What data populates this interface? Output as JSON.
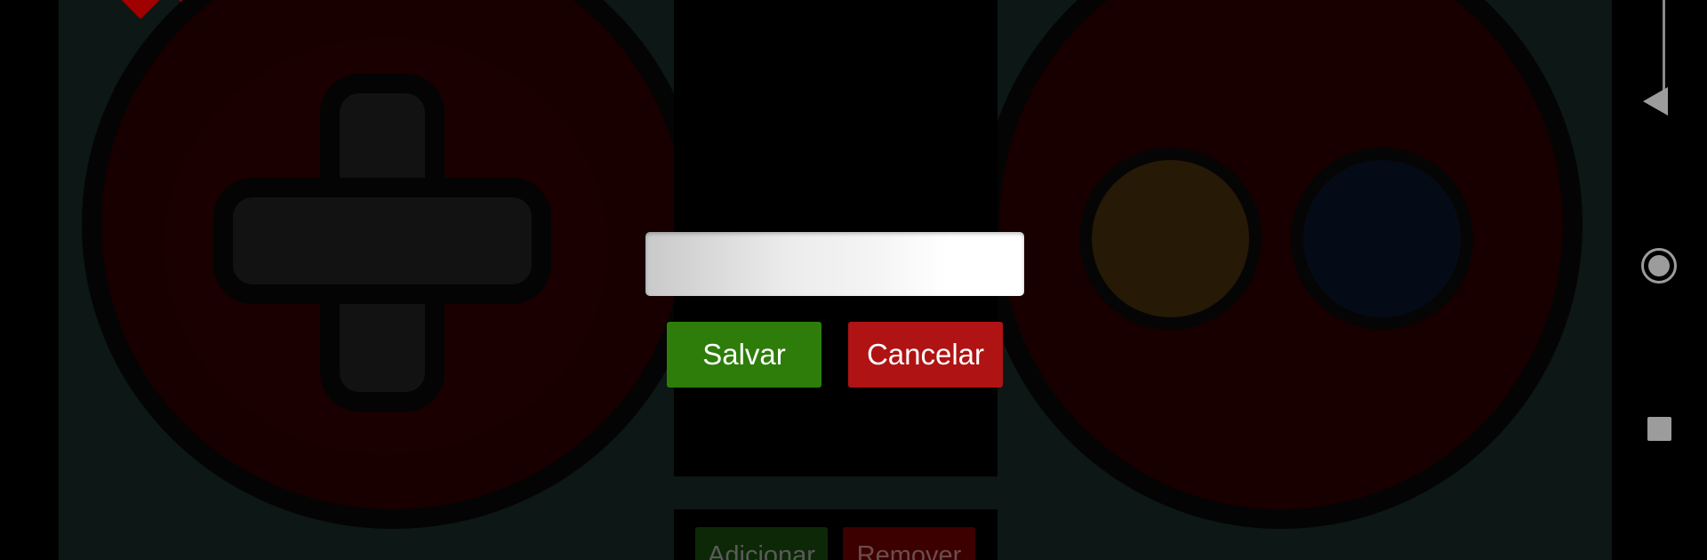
{
  "dialog": {
    "name_input": {
      "value": "",
      "placeholder": ""
    },
    "save_label": "Salvar",
    "cancel_label": "Cancelar"
  },
  "toolbar": {
    "add_label": "Adicionar",
    "remove_label": "Remover"
  },
  "controller": {
    "left_pad": {
      "icon": "dpad-icon"
    },
    "right_pad": {
      "buttons": [
        {
          "name": "yellow-face-button",
          "color": "#261906"
        },
        {
          "name": "blue-face-button",
          "color": "#050b16"
        }
      ]
    }
  },
  "nav_bar": {
    "icons": [
      "back-icon",
      "home-icon",
      "recent-apps-icon"
    ]
  },
  "colors": {
    "save": "#2e7d0a",
    "cancel": "#b01313",
    "pad_fill": "#180000"
  }
}
